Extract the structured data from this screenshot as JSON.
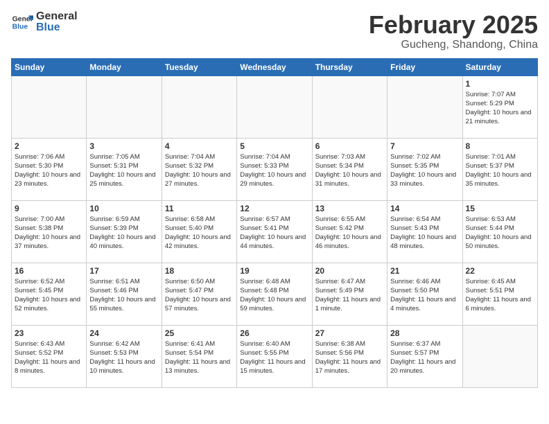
{
  "header": {
    "logo_general": "General",
    "logo_blue": "Blue",
    "month_title": "February 2025",
    "location": "Gucheng, Shandong, China"
  },
  "weekdays": [
    "Sunday",
    "Monday",
    "Tuesday",
    "Wednesday",
    "Thursday",
    "Friday",
    "Saturday"
  ],
  "weeks": [
    [
      {
        "day": "",
        "info": ""
      },
      {
        "day": "",
        "info": ""
      },
      {
        "day": "",
        "info": ""
      },
      {
        "day": "",
        "info": ""
      },
      {
        "day": "",
        "info": ""
      },
      {
        "day": "",
        "info": ""
      },
      {
        "day": "1",
        "info": "Sunrise: 7:07 AM\nSunset: 5:29 PM\nDaylight: 10 hours\nand 21 minutes."
      }
    ],
    [
      {
        "day": "2",
        "info": "Sunrise: 7:06 AM\nSunset: 5:30 PM\nDaylight: 10 hours\nand 23 minutes."
      },
      {
        "day": "3",
        "info": "Sunrise: 7:05 AM\nSunset: 5:31 PM\nDaylight: 10 hours\nand 25 minutes."
      },
      {
        "day": "4",
        "info": "Sunrise: 7:04 AM\nSunset: 5:32 PM\nDaylight: 10 hours\nand 27 minutes."
      },
      {
        "day": "5",
        "info": "Sunrise: 7:04 AM\nSunset: 5:33 PM\nDaylight: 10 hours\nand 29 minutes."
      },
      {
        "day": "6",
        "info": "Sunrise: 7:03 AM\nSunset: 5:34 PM\nDaylight: 10 hours\nand 31 minutes."
      },
      {
        "day": "7",
        "info": "Sunrise: 7:02 AM\nSunset: 5:35 PM\nDaylight: 10 hours\nand 33 minutes."
      },
      {
        "day": "8",
        "info": "Sunrise: 7:01 AM\nSunset: 5:37 PM\nDaylight: 10 hours\nand 35 minutes."
      }
    ],
    [
      {
        "day": "9",
        "info": "Sunrise: 7:00 AM\nSunset: 5:38 PM\nDaylight: 10 hours\nand 37 minutes."
      },
      {
        "day": "10",
        "info": "Sunrise: 6:59 AM\nSunset: 5:39 PM\nDaylight: 10 hours\nand 40 minutes."
      },
      {
        "day": "11",
        "info": "Sunrise: 6:58 AM\nSunset: 5:40 PM\nDaylight: 10 hours\nand 42 minutes."
      },
      {
        "day": "12",
        "info": "Sunrise: 6:57 AM\nSunset: 5:41 PM\nDaylight: 10 hours\nand 44 minutes."
      },
      {
        "day": "13",
        "info": "Sunrise: 6:55 AM\nSunset: 5:42 PM\nDaylight: 10 hours\nand 46 minutes."
      },
      {
        "day": "14",
        "info": "Sunrise: 6:54 AM\nSunset: 5:43 PM\nDaylight: 10 hours\nand 48 minutes."
      },
      {
        "day": "15",
        "info": "Sunrise: 6:53 AM\nSunset: 5:44 PM\nDaylight: 10 hours\nand 50 minutes."
      }
    ],
    [
      {
        "day": "16",
        "info": "Sunrise: 6:52 AM\nSunset: 5:45 PM\nDaylight: 10 hours\nand 52 minutes."
      },
      {
        "day": "17",
        "info": "Sunrise: 6:51 AM\nSunset: 5:46 PM\nDaylight: 10 hours\nand 55 minutes."
      },
      {
        "day": "18",
        "info": "Sunrise: 6:50 AM\nSunset: 5:47 PM\nDaylight: 10 hours\nand 57 minutes."
      },
      {
        "day": "19",
        "info": "Sunrise: 6:48 AM\nSunset: 5:48 PM\nDaylight: 10 hours\nand 59 minutes."
      },
      {
        "day": "20",
        "info": "Sunrise: 6:47 AM\nSunset: 5:49 PM\nDaylight: 11 hours\nand 1 minute."
      },
      {
        "day": "21",
        "info": "Sunrise: 6:46 AM\nSunset: 5:50 PM\nDaylight: 11 hours\nand 4 minutes."
      },
      {
        "day": "22",
        "info": "Sunrise: 6:45 AM\nSunset: 5:51 PM\nDaylight: 11 hours\nand 6 minutes."
      }
    ],
    [
      {
        "day": "23",
        "info": "Sunrise: 6:43 AM\nSunset: 5:52 PM\nDaylight: 11 hours\nand 8 minutes."
      },
      {
        "day": "24",
        "info": "Sunrise: 6:42 AM\nSunset: 5:53 PM\nDaylight: 11 hours\nand 10 minutes."
      },
      {
        "day": "25",
        "info": "Sunrise: 6:41 AM\nSunset: 5:54 PM\nDaylight: 11 hours\nand 13 minutes."
      },
      {
        "day": "26",
        "info": "Sunrise: 6:40 AM\nSunset: 5:55 PM\nDaylight: 11 hours\nand 15 minutes."
      },
      {
        "day": "27",
        "info": "Sunrise: 6:38 AM\nSunset: 5:56 PM\nDaylight: 11 hours\nand 17 minutes."
      },
      {
        "day": "28",
        "info": "Sunrise: 6:37 AM\nSunset: 5:57 PM\nDaylight: 11 hours\nand 20 minutes."
      },
      {
        "day": "",
        "info": ""
      }
    ]
  ]
}
